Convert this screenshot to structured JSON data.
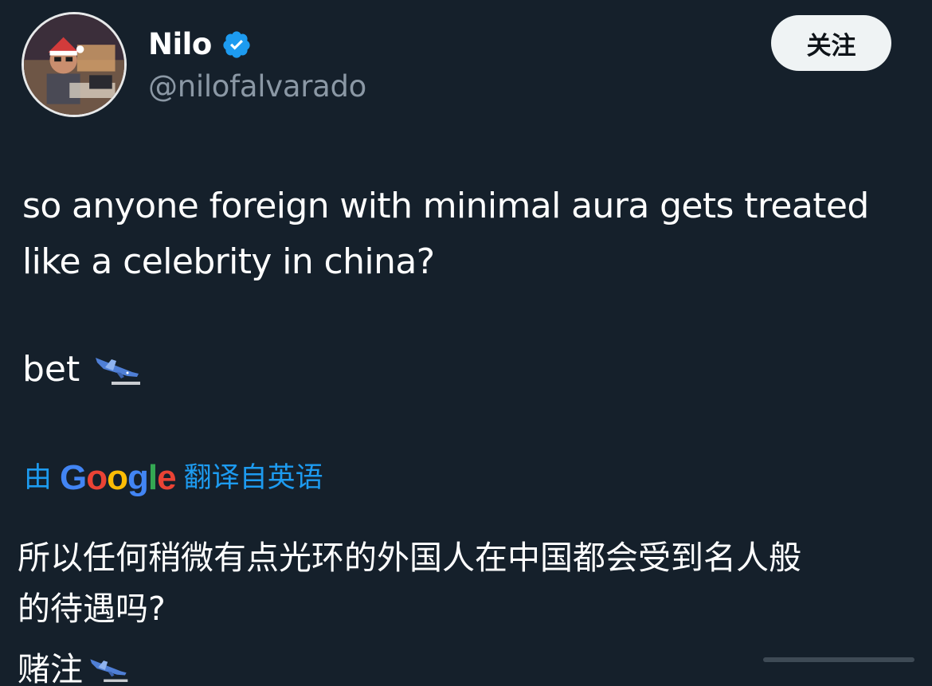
{
  "user": {
    "display_name": "Nilo",
    "handle": "@nilofalvarado",
    "verified": true
  },
  "follow_button": {
    "label": "关注"
  },
  "tweet": {
    "lines": [
      "so anyone foreign with minimal aura gets treated",
      "like a celebrity in china?"
    ],
    "bet_text": "bet",
    "emoji": "airplane-landing-icon"
  },
  "translation": {
    "prefix": "由",
    "provider": "Google",
    "suffix": "翻译自英语",
    "lines": [
      "所以任何稍微有点光环的外国人在中国都会受到名人般",
      "的待遇吗?"
    ],
    "bet_text": "赌注"
  },
  "colors": {
    "background": "#15202b",
    "link_blue": "#1d9bf0",
    "secondary_text": "#8b98a5",
    "verified_badge": "#1d9bf0",
    "follow_button_bg": "#eff3f4"
  }
}
